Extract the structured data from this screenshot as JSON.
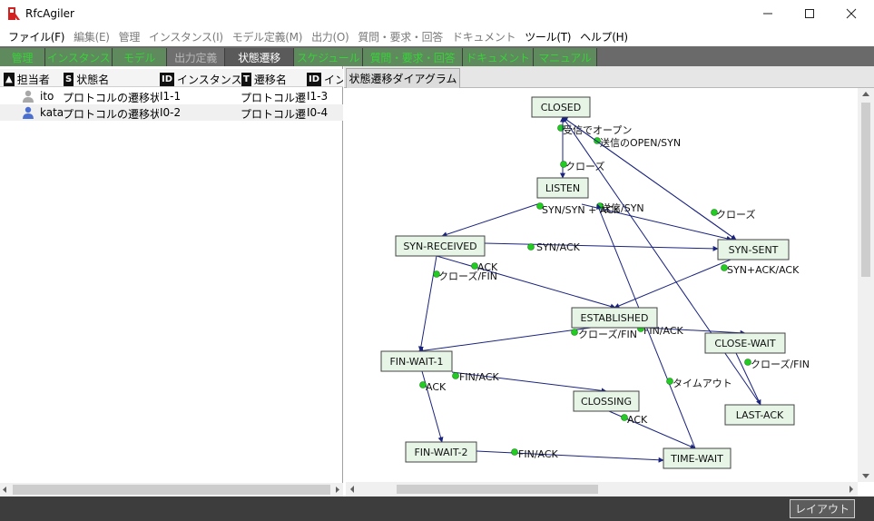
{
  "window": {
    "title": "RfcAgiler"
  },
  "menu": [
    {
      "label": "ファイル(F)",
      "enabled": true
    },
    {
      "label": "編集(E)",
      "enabled": false
    },
    {
      "label": "管理",
      "enabled": false
    },
    {
      "label": "インスタンス(I)",
      "enabled": false
    },
    {
      "label": "モデル定義(M)",
      "enabled": false
    },
    {
      "label": "出力(O)",
      "enabled": false
    },
    {
      "label": "質問・要求・回答",
      "enabled": false
    },
    {
      "label": "ドキュメント",
      "enabled": false
    },
    {
      "label": "ツール(T)",
      "enabled": true
    },
    {
      "label": "ヘルプ(H)",
      "enabled": true
    }
  ],
  "tabs": [
    {
      "label": "管理",
      "state": "normal"
    },
    {
      "label": "インスタンス",
      "state": "normal"
    },
    {
      "label": "モデル",
      "state": "normal"
    },
    {
      "label": "出力定義",
      "state": "disabled"
    },
    {
      "label": "状態遷移",
      "state": "active"
    },
    {
      "label": "スケジュール",
      "state": "normal"
    },
    {
      "label": "質問・要求・回答",
      "state": "normal"
    },
    {
      "label": "ドキュメント",
      "state": "normal"
    },
    {
      "label": "マニュアル",
      "state": "normal"
    }
  ],
  "table": {
    "columns": [
      {
        "badge": "▲",
        "label": "担当者"
      },
      {
        "badge": "S",
        "label": "状態名"
      },
      {
        "badge": "ID",
        "label": "インスタンスID"
      },
      {
        "badge": "T",
        "label": "遷移名"
      },
      {
        "badge": "ID",
        "label": "インスタ"
      }
    ],
    "rows": [
      {
        "user": "ito",
        "state_name": "プロトコルの遷移状態",
        "instance_id": "I1-1",
        "transition_name": "プロトコル遷移",
        "id2": "I1-3",
        "avatar_color": "#a8a8a8"
      },
      {
        "user": "kata",
        "state_name": "プロトコルの遷移状態",
        "instance_id": "I0-2",
        "transition_name": "プロトコル遷移",
        "id2": "I0-4",
        "avatar_color": "#4a6fd0"
      }
    ]
  },
  "diagram": {
    "tab_label": "状態遷移ダイアグラム",
    "states": [
      {
        "id": "closed",
        "label": "CLOSED"
      },
      {
        "id": "listen",
        "label": "LISTEN"
      },
      {
        "id": "syn_received",
        "label": "SYN-RECEIVED"
      },
      {
        "id": "syn_sent",
        "label": "SYN-SENT"
      },
      {
        "id": "established",
        "label": "ESTABLISHED"
      },
      {
        "id": "fin_wait_1",
        "label": "FIN-WAIT-1"
      },
      {
        "id": "close_wait",
        "label": "CLOSE-WAIT"
      },
      {
        "id": "closing",
        "label": "CLOSSING"
      },
      {
        "id": "last_ack",
        "label": "LAST-ACK"
      },
      {
        "id": "fin_wait_2",
        "label": "FIN-WAIT-2"
      },
      {
        "id": "time_wait",
        "label": "TIME-WAIT"
      }
    ],
    "transitions": [
      {
        "from": "closed",
        "to": "listen",
        "label": "受信でオープン"
      },
      {
        "from": "closed",
        "to": "syn_sent",
        "label": "送信のOPEN/SYN"
      },
      {
        "from": "listen",
        "to": "closed",
        "label": "クローズ"
      },
      {
        "from": "listen",
        "to": "syn_received",
        "label": "SYN/SYN + ACK"
      },
      {
        "from": "listen",
        "to": "syn_sent",
        "label": "送信/SYN"
      },
      {
        "from": "syn_sent",
        "to": "closed",
        "label": "クローズ"
      },
      {
        "from": "syn_received",
        "to": "syn_sent",
        "label": "SYN/ACK"
      },
      {
        "from": "syn_received",
        "to": "established",
        "label": "ACK"
      },
      {
        "from": "syn_received",
        "to": "fin_wait_1",
        "label": "クローズ/FIN"
      },
      {
        "from": "syn_sent",
        "to": "established",
        "label": "SYN+ACK/ACK"
      },
      {
        "from": "established",
        "to": "fin_wait_1",
        "label": "クローズ/FIN"
      },
      {
        "from": "established",
        "to": "close_wait",
        "label": "FIN/ACK"
      },
      {
        "from": "close_wait",
        "to": "last_ack",
        "label": "クローズ/FIN"
      },
      {
        "from": "last_ack",
        "to": "closed",
        "label": "ACK"
      },
      {
        "from": "fin_wait_1",
        "to": "closing",
        "label": "FIN/ACK"
      },
      {
        "from": "fin_wait_1",
        "to": "fin_wait_2",
        "label": "ACK"
      },
      {
        "from": "closing",
        "to": "time_wait",
        "label": "ACK"
      },
      {
        "from": "fin_wait_2",
        "to": "time_wait",
        "label": "FIN/ACK"
      },
      {
        "from": "time_wait",
        "to": "closed",
        "label": "タイムアウト"
      }
    ]
  },
  "status": {
    "layout_button": "レイアウト"
  },
  "colors": {
    "state_fill": "#e6f5e6",
    "handle": "#22cc22",
    "edge": "#1a237e",
    "tab_text": "#39d239"
  }
}
